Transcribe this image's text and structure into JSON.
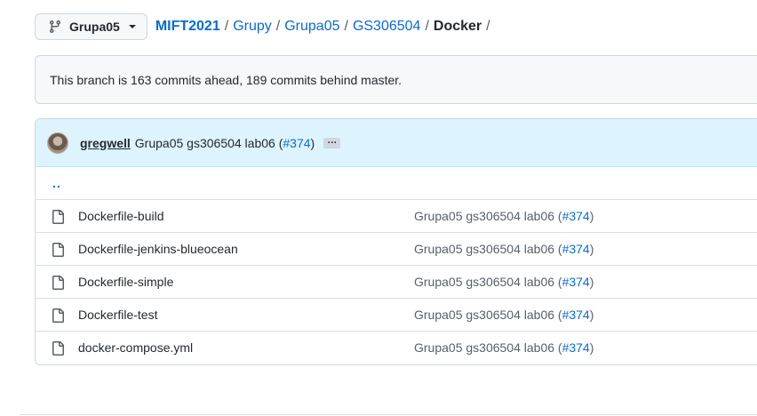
{
  "branch": {
    "name": "Grupa05"
  },
  "breadcrumb": {
    "root": "MIFT2021",
    "parts": [
      "Grupy",
      "Grupa05",
      "GS306504"
    ],
    "current": "Docker",
    "separator": "/"
  },
  "notice": {
    "text": "This branch is 163 commits ahead, 189 commits behind master."
  },
  "latest_commit": {
    "author": "gregwell",
    "message": "Grupa05 gs306504 lab06 (",
    "pr": "#374",
    "close": ")",
    "ellipsis": "…"
  },
  "parent_dir": "..",
  "files": [
    {
      "name": "Dockerfile-build",
      "commit": "Grupa05 gs306504 lab06 (",
      "pr": "#374",
      "close": ")"
    },
    {
      "name": "Dockerfile-jenkins-blueocean",
      "commit": "Grupa05 gs306504 lab06 (",
      "pr": "#374",
      "close": ")"
    },
    {
      "name": "Dockerfile-simple",
      "commit": "Grupa05 gs306504 lab06 (",
      "pr": "#374",
      "close": ")"
    },
    {
      "name": "Dockerfile-test",
      "commit": "Grupa05 gs306504 lab06 (",
      "pr": "#374",
      "close": ")"
    },
    {
      "name": "docker-compose.yml",
      "commit": "Grupa05 gs306504 lab06 (",
      "pr": "#374",
      "close": ")"
    }
  ],
  "icons": {
    "branch": "git-branch-icon",
    "file": "file-icon",
    "caret": "caret-down-icon"
  },
  "colors": {
    "link": "#0969da",
    "commit_bar": "#ddf4ff",
    "border": "#d0d7de"
  }
}
